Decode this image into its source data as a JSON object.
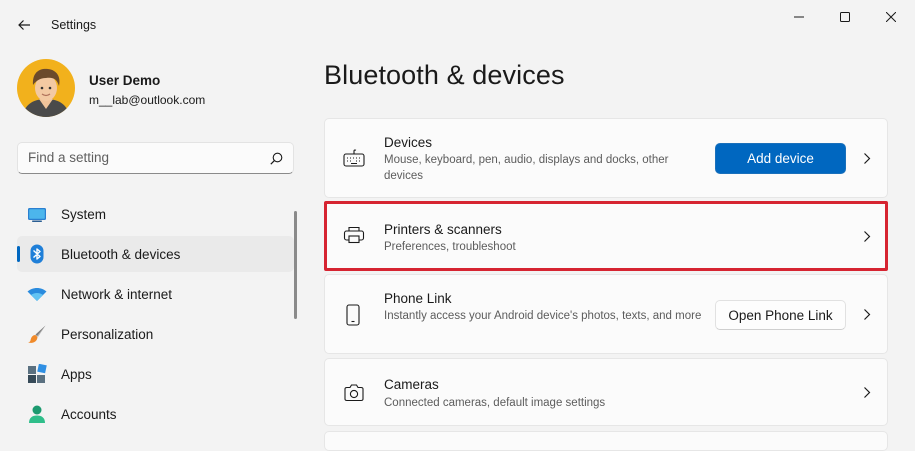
{
  "app": {
    "title": "Settings"
  },
  "profile": {
    "name": "User Demo",
    "email": "m__lab@outlook.com"
  },
  "search": {
    "placeholder": "Find a setting"
  },
  "nav": {
    "items": [
      {
        "label": "System",
        "icon": "monitor-icon",
        "active": false
      },
      {
        "label": "Bluetooth & devices",
        "icon": "bluetooth-icon",
        "active": true
      },
      {
        "label": "Network & internet",
        "icon": "wifi-icon",
        "active": false
      },
      {
        "label": "Personalization",
        "icon": "paintbrush-icon",
        "active": false
      },
      {
        "label": "Apps",
        "icon": "apps-icon",
        "active": false
      },
      {
        "label": "Accounts",
        "icon": "person-icon",
        "active": false
      }
    ]
  },
  "main": {
    "title": "Bluetooth & devices",
    "cards": [
      {
        "title": "Devices",
        "desc": "Mouse, keyboard, pen, audio, displays and docks, other devices",
        "button": "Add device",
        "icon": "keyboard-icon"
      },
      {
        "title": "Printers & scanners",
        "desc": "Preferences, troubleshoot",
        "icon": "printer-icon"
      },
      {
        "title": "Phone Link",
        "desc": "Instantly access your Android device's photos, texts, and more",
        "button": "Open Phone Link",
        "icon": "phone-icon"
      },
      {
        "title": "Cameras",
        "desc": "Connected cameras, default image settings",
        "icon": "camera-icon"
      }
    ]
  },
  "colors": {
    "accent": "#0067c0",
    "highlight": "#d62431",
    "background": "#f3f3f3"
  }
}
